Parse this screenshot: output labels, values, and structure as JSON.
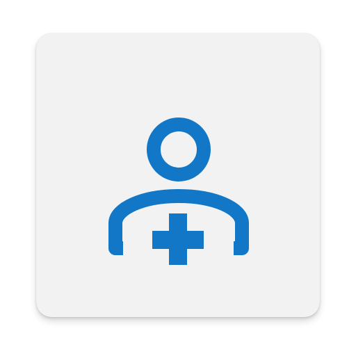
{
  "app_icon": {
    "icon_name": "person-plus-icon",
    "accent_color": "#1177c6",
    "tile_color": "#f2f2f2"
  }
}
